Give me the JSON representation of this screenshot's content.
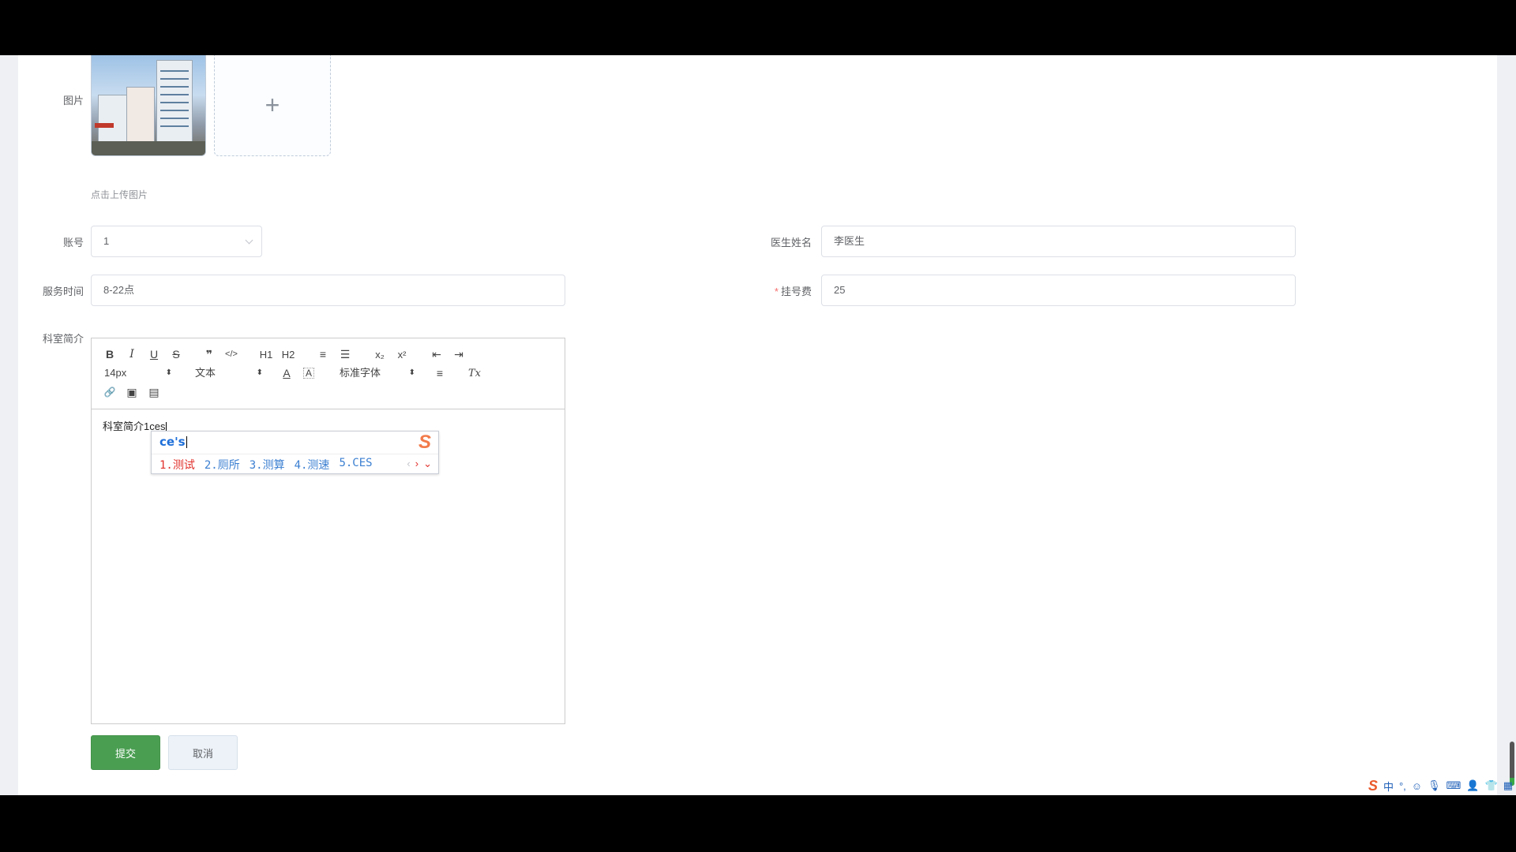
{
  "form": {
    "image": {
      "label": "图片",
      "upload_tip": "点击上传图片",
      "add_symbol": "+"
    },
    "account": {
      "label": "账号",
      "value": "1"
    },
    "doctor_name": {
      "label": "医生姓名",
      "value": "李医生"
    },
    "service_time": {
      "label": "服务时间",
      "value": "8-22点"
    },
    "registration_fee": {
      "label": "挂号费",
      "required_mark": "*",
      "value": "25"
    },
    "dept_intro": {
      "label": "科室简介"
    }
  },
  "editor": {
    "toolbar": {
      "bold": "B",
      "italic": "I",
      "underline": "U",
      "strike": "S",
      "quote": "❞",
      "code": "</>",
      "h1": "H1",
      "h2": "H2",
      "ordered_list": "≡",
      "bullet_list": "☰",
      "subscript": "x₂",
      "superscript": "x²",
      "outdent": "⇤",
      "indent": "⇥",
      "size": "14px",
      "header": "文本",
      "color": "A",
      "background": "A",
      "font": "标准字体",
      "align": "≡",
      "clean": "Tx",
      "link": "🔗",
      "image": "▣",
      "video": "▤",
      "updown": "⬍"
    },
    "content": "科室简介1ces"
  },
  "ime": {
    "input": "ce's",
    "candidates": [
      "1.测试",
      "2.厕所",
      "3.测算",
      "4.测速",
      "5.CES"
    ],
    "logo": "S",
    "prev": "‹",
    "next": "›",
    "expand": "⌄"
  },
  "buttons": {
    "submit": "提交",
    "cancel": "取消"
  },
  "tray": {
    "logo": "S",
    "lang": "中",
    "punct": "°,",
    "emoji": "☺",
    "mic": "🎙",
    "keyboard": "⌨",
    "user": "👤",
    "skin": "👕",
    "tools": "▦"
  }
}
